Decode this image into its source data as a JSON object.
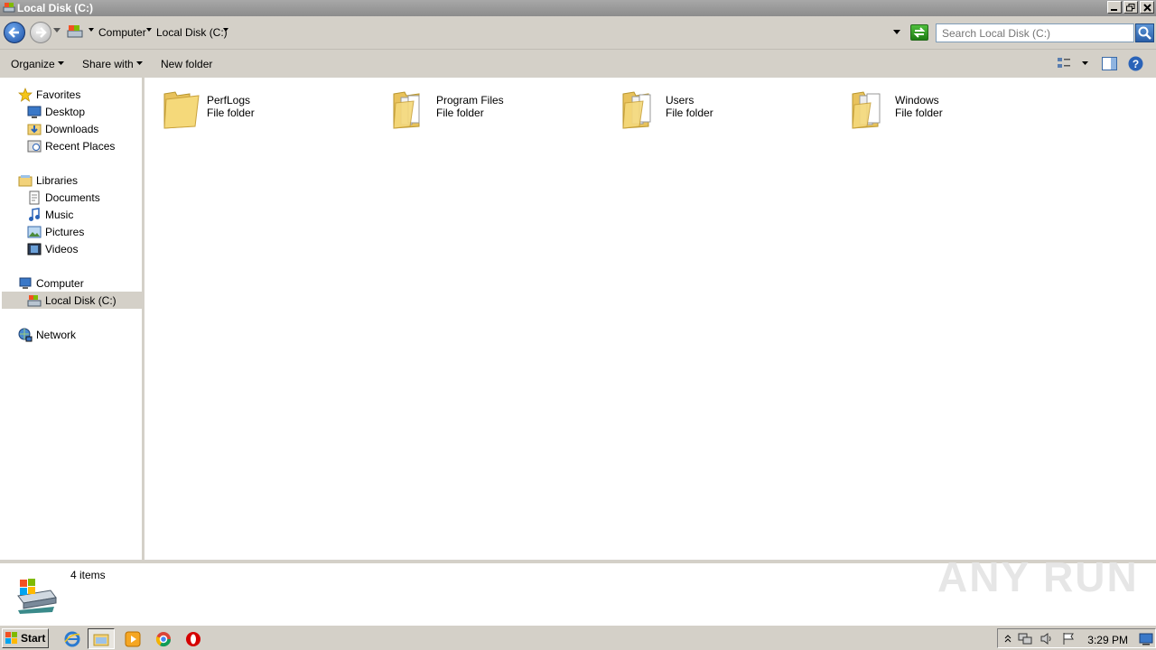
{
  "window": {
    "title": "Local Disk (C:)"
  },
  "address": {
    "crumbs": [
      "Computer",
      "Local Disk (C:)"
    ],
    "search_placeholder": "Search Local Disk (C:)"
  },
  "commands": {
    "organize": "Organize",
    "share_with": "Share with",
    "new_folder": "New folder"
  },
  "nav": {
    "favorites": "Favorites",
    "desktop": "Desktop",
    "downloads": "Downloads",
    "recent_places": "Recent Places",
    "libraries": "Libraries",
    "documents": "Documents",
    "music": "Music",
    "pictures": "Pictures",
    "videos": "Videos",
    "computer": "Computer",
    "local_disk": "Local Disk (C:)",
    "network": "Network"
  },
  "items": [
    {
      "name": "PerfLogs",
      "type": "File folder"
    },
    {
      "name": "Program Files",
      "type": "File folder"
    },
    {
      "name": "Users",
      "type": "File folder"
    },
    {
      "name": "Windows",
      "type": "File folder"
    }
  ],
  "details": {
    "count": "4 items"
  },
  "watermark": "ANY RUN",
  "taskbar": {
    "start": "Start",
    "clock": "3:29 PM"
  },
  "colors": {
    "chrome": "#d4d0c8",
    "titlebar": "#8c8c8c",
    "selection": "#d4d0c8",
    "folder": "#f5d97a"
  }
}
